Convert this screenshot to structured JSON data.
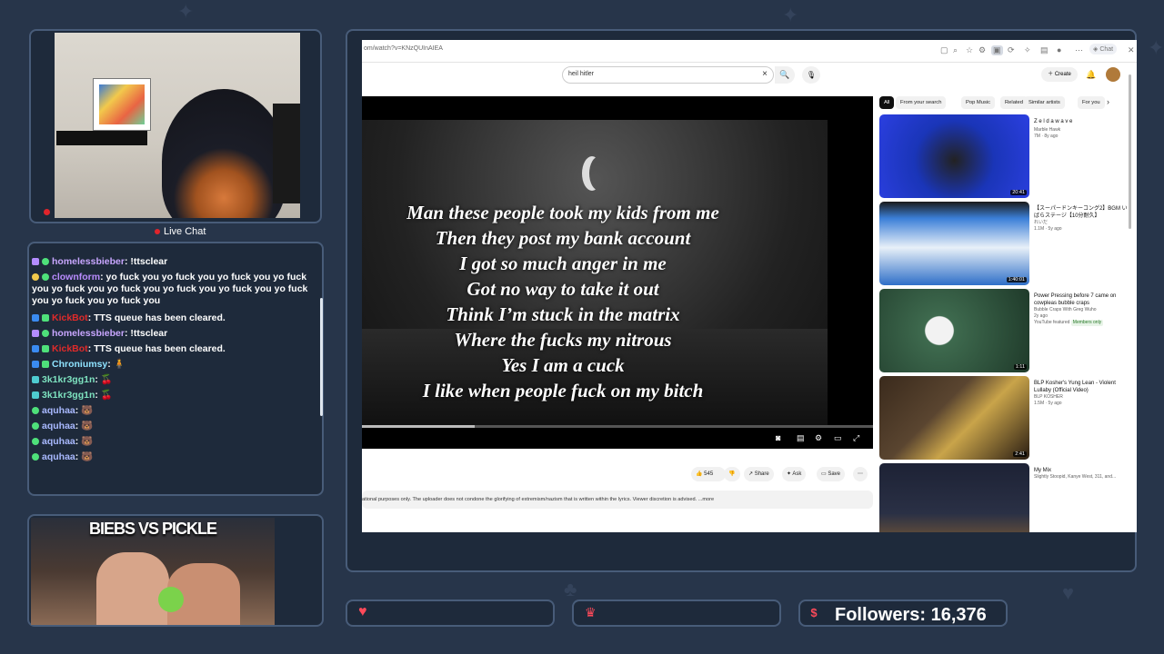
{
  "webcam": {
    "live_chat_label": "Live Chat"
  },
  "chat": {
    "messages": [
      {
        "name": "homelessbieber",
        "name_color": "#c8a6ff",
        "text": "!ttsclear"
      },
      {
        "name": "clownform",
        "name_color": "#b98cff",
        "text": "yo fuck you yo fuck you yo fuck you yo fuck you yo fuck you yo fuck you yo fuck you yo fuck you yo fuck you yo fuck you yo fuck you"
      },
      {
        "name": "KickBot",
        "name_color": "#e02a2a",
        "text": "TTS queue has been cleared."
      },
      {
        "name": "homelessbieber",
        "name_color": "#c8a6ff",
        "text": "!ttsclear"
      },
      {
        "name": "KickBot",
        "name_color": "#e02a2a",
        "text": "TTS queue has been cleared."
      },
      {
        "name": "Chroniumsy",
        "name_color": "#8fe3ff",
        "text": ""
      },
      {
        "name": "3k1kr3gg1n",
        "name_color": "#7ee3c0",
        "text": ""
      },
      {
        "name": "3k1kr3gg1n",
        "name_color": "#7ee3c0",
        "text": ""
      },
      {
        "name": "aquhaa",
        "name_color": "#a9b9ff",
        "text": ""
      },
      {
        "name": "aquhaa",
        "name_color": "#a9b9ff",
        "text": ""
      },
      {
        "name": "aquhaa",
        "name_color": "#a9b9ff",
        "text": ""
      },
      {
        "name": "aquhaa",
        "name_color": "#a9b9ff",
        "text": ""
      }
    ]
  },
  "biebs": {
    "title": "BIEBS VS PICKLE"
  },
  "browser": {
    "url": "om/watch?v=KNzQUInAIEA",
    "search_value": "heil hitler",
    "create_label": "Create",
    "chat_label": "Chat",
    "lyrics": [
      "Man these people took my kids from me",
      "Then they post my bank account",
      "I got so much anger in me",
      "Got no way to take it out",
      "Think I’m stuck in the matrix",
      "Where the fucks my nitrous",
      "Yes I am a cuck",
      "I like when people fuck on my bitch"
    ],
    "progress_fraction": 0.22,
    "actions": {
      "likes": "545",
      "share": "Share",
      "ask": "Ask",
      "save": "Save"
    },
    "description": "ational purposes only. The uploader does not condone the glorifying of extremism/nazism that is written within the lyrics. Viewer discretion is advised.",
    "description_more": "...more",
    "chips": [
      "All",
      "From your search",
      "Pop Music",
      "Related",
      "Similar artists",
      "For you"
    ],
    "recommendations": [
      {
        "title": "Z e l d a w a v e",
        "channel": "Marble Hawk",
        "meta": "7M · 8y ago",
        "duration": "20:41",
        "thumb": "#1a35b8"
      },
      {
        "title": "【スーパードンキーコング2】BGM いばらステージ【10分耐久】",
        "channel": "れいだ",
        "meta": "1.1M · 5y ago",
        "duration": "1:40:01",
        "thumb": "#2f6fc8"
      },
      {
        "title": "Power Pressing before 7 came on cowpleas bubble craps",
        "channel": "Bubble Craps With Greg Wuho",
        "meta": "2y ago",
        "badge1": "YouTube featured",
        "badge2": "Members only",
        "duration": "1:11",
        "thumb": "#3e6a4e"
      },
      {
        "title": "BLP Kosher's Yung Lean - Violent Lullaby (Official Video)",
        "channel": "BLP KOSHER",
        "meta": "1.5M · 5y ago",
        "duration": "2:41",
        "thumb": "#5a4530"
      },
      {
        "title": "My Mix",
        "channel": "Slightly Stoopid, Kanye West, 311, and...",
        "meta": "",
        "duration": "",
        "thumb": "#2a3045"
      }
    ]
  },
  "bottom": {
    "followers_text": "Followers: 16,376"
  }
}
